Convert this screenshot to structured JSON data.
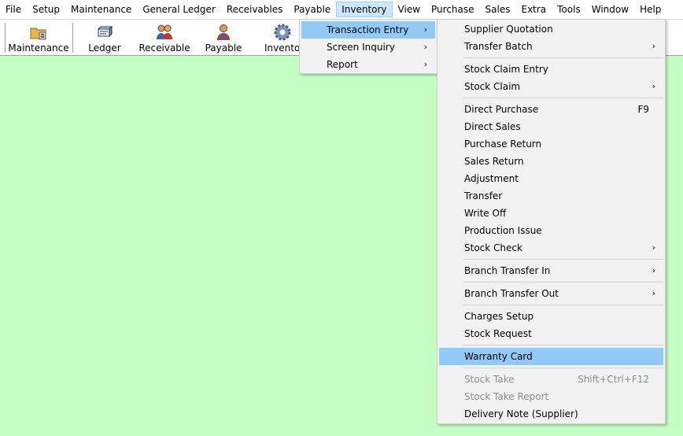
{
  "menubar": {
    "items": [
      "File",
      "Setup",
      "Maintenance",
      "General Ledger",
      "Receivables",
      "Payable",
      "Inventory",
      "View",
      "Purchase",
      "Sales",
      "Extra",
      "Tools",
      "Window",
      "Help"
    ]
  },
  "toolbar": {
    "buttons": [
      {
        "label": "Maintenance",
        "icon": "folder-settings-icon"
      },
      {
        "label": "Ledger",
        "icon": "ledger-book-icon"
      },
      {
        "label": "Receivable",
        "icon": "users-icon"
      },
      {
        "label": "Payable",
        "icon": "user-payable-icon"
      },
      {
        "label": "Inventory",
        "icon": "gear-icon"
      }
    ]
  },
  "inventory_menu": {
    "items": [
      {
        "label": "Transaction Entry",
        "submenu": true,
        "state": "highlighted"
      },
      {
        "label": "Screen Inquiry",
        "submenu": true
      },
      {
        "label": "Report",
        "submenu": true
      }
    ]
  },
  "transaction_menu": {
    "items": [
      {
        "label": "Supplier Quotation"
      },
      {
        "label": "Transfer Batch",
        "submenu": true
      },
      {
        "label": "Stock Claim Entry"
      },
      {
        "label": "Stock Claim",
        "submenu": true
      },
      {
        "label": "Direct Purchase",
        "shortcut": "F9"
      },
      {
        "label": "Direct Sales"
      },
      {
        "label": "Purchase Return"
      },
      {
        "label": "Sales Return"
      },
      {
        "label": "Adjustment"
      },
      {
        "label": "Transfer"
      },
      {
        "label": "Write Off"
      },
      {
        "label": "Production Issue"
      },
      {
        "label": "Stock Check",
        "submenu": true
      },
      {
        "label": "Branch Transfer In",
        "submenu": true
      },
      {
        "label": "Branch Transfer Out",
        "submenu": true
      },
      {
        "label": "Charges Setup"
      },
      {
        "label": "Stock Request"
      },
      {
        "label": "Warranty Card",
        "state": "highlighted"
      },
      {
        "label": "Stock Take",
        "shortcut": "Shift+Ctrl+F12",
        "state": "disabled"
      },
      {
        "label": "Stock Take Report",
        "state": "disabled"
      },
      {
        "label": "Delivery Note (Supplier)"
      }
    ]
  },
  "glyphs": {
    "submenu_arrow": "›"
  },
  "colors": {
    "desktop": "#c4ffc4",
    "highlight": "#91c9f7",
    "menubar_active": "#cce8ff"
  }
}
